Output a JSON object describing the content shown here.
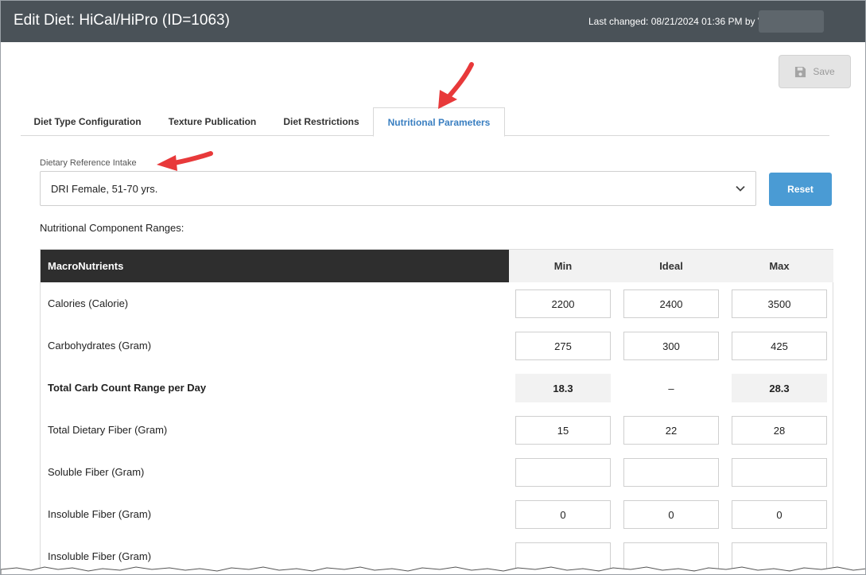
{
  "header": {
    "title": "Edit Diet: HiCal/HiPro (ID=1063)",
    "last_changed": "Last changed: 08/21/2024 01:36 PM by V"
  },
  "toolbar": {
    "save_label": "Save"
  },
  "tabs": [
    {
      "label": "Diet Type Configuration",
      "active": false
    },
    {
      "label": "Texture Publication",
      "active": false
    },
    {
      "label": "Diet Restrictions",
      "active": false
    },
    {
      "label": "Nutritional Parameters",
      "active": true
    }
  ],
  "dri": {
    "label": "Dietary Reference Intake",
    "selected": "DRI Female, 51-70 yrs.",
    "reset_label": "Reset"
  },
  "ranges_label": "Nutritional Component Ranges:",
  "table": {
    "section": "MacroNutrients",
    "columns": [
      "Min",
      "Ideal",
      "Max"
    ],
    "rows": [
      {
        "label": "Calories (Calorie)",
        "min": "2200",
        "ideal": "2400",
        "max": "3500",
        "readonly": false
      },
      {
        "label": "Carbohydrates (Gram)",
        "min": "275",
        "ideal": "300",
        "max": "425",
        "readonly": false
      },
      {
        "label": "Total Carb Count Range per Day",
        "min": "18.3",
        "ideal": "–",
        "max": "28.3",
        "readonly": true
      },
      {
        "label": "Total Dietary Fiber (Gram)",
        "min": "15",
        "ideal": "22",
        "max": "28",
        "readonly": false
      },
      {
        "label": "Soluble Fiber (Gram)",
        "min": "",
        "ideal": "",
        "max": "",
        "readonly": false
      },
      {
        "label": "Insoluble Fiber (Gram)",
        "min": "0",
        "ideal": "0",
        "max": "0",
        "readonly": false
      },
      {
        "label": "Insoluble Fiber (Gram)",
        "min": "",
        "ideal": "",
        "max": "",
        "readonly": false
      }
    ]
  },
  "colors": {
    "header_bg": "#4a5258",
    "accent": "#3a7fc1",
    "reset_bg": "#4a9bd4",
    "arrow": "#e8393a",
    "table_head_bg": "#2e2e2e"
  },
  "icons": {
    "save": "floppy-disk-icon",
    "dropdown": "chevron-down-icon",
    "annotation": "red-arrow-icon"
  }
}
